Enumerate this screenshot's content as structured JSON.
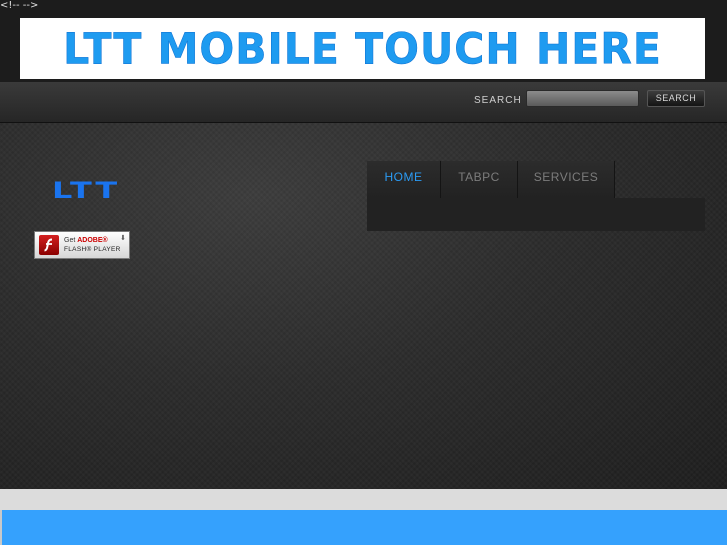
{
  "stray_text": "<!-- -->",
  "header": {
    "banner_text": "LTT MOBILE TOUCH HERE"
  },
  "search": {
    "label": "SEARCH",
    "input_value": "",
    "button_label": "SEARCH"
  },
  "sidebar": {
    "logo_text": "LTT",
    "flash_badge": {
      "line1_prefix": "Get",
      "line1_brand": "ADOBE®",
      "line2": "FLASH® PLAYER",
      "icon": "flash-logo-icon"
    }
  },
  "nav": {
    "tabs": [
      {
        "label": "HOME",
        "active": true
      },
      {
        "label": "TABPC",
        "active": false
      },
      {
        "label": "SERVICES",
        "active": false
      }
    ]
  },
  "colors": {
    "accent": "#2b9bf4",
    "banner_text": "#1e9bf0",
    "footer_blue": "#35a1fd",
    "footer_gray": "#dcdcdc"
  }
}
